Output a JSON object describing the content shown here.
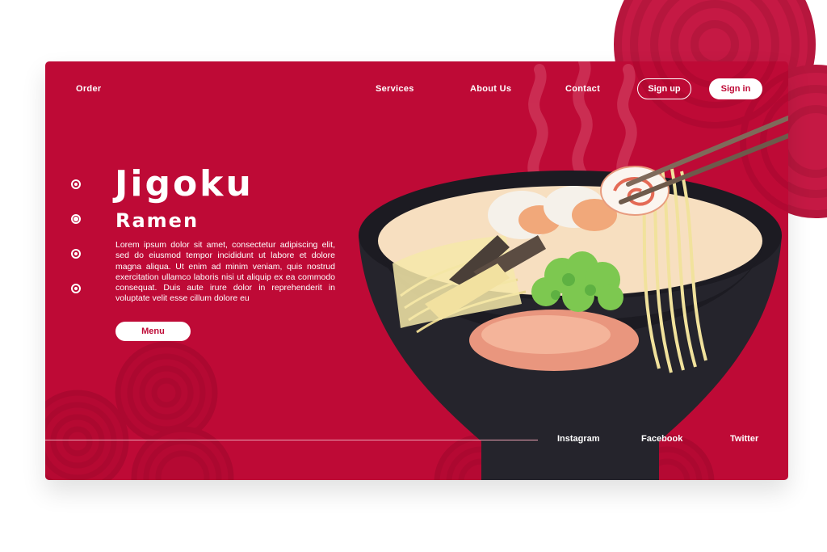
{
  "nav": {
    "order": "Order",
    "services": "Services",
    "about": "About Us",
    "contact": "Contact",
    "signup": "Sign up",
    "signin": "Sign in"
  },
  "hero": {
    "title_line1": "Jigoku",
    "title_line2": "Ramen",
    "description": "Lorem ipsum dolor sit amet, consectetur adipiscing elit, sed do eiusmod tempor incididunt ut labore et dolore magna aliqua. Ut enim ad minim veniam, quis nostrud exercitation ullamco laboris nisi ut aliquip ex ea commodo consequat. Duis aute irure dolor in reprehenderit in voluptate velit esse cillum dolore eu",
    "menu_button": "Menu"
  },
  "slider": {
    "count": 4,
    "active_index": 1
  },
  "footer": {
    "instagram": "Instagram",
    "facebook": "Facebook",
    "twitter": "Twitter"
  },
  "colors": {
    "brand_red": "#be0a36",
    "bowl": "#25242c",
    "broth": "#f7dfc0",
    "noodles": "#f6e9a9",
    "white": "#ffffff"
  },
  "icons": [
    "slider-dot-icon",
    "ramen-bowl-illustration",
    "chopsticks-icon",
    "steam-icon",
    "wave-pattern-decoration"
  ]
}
